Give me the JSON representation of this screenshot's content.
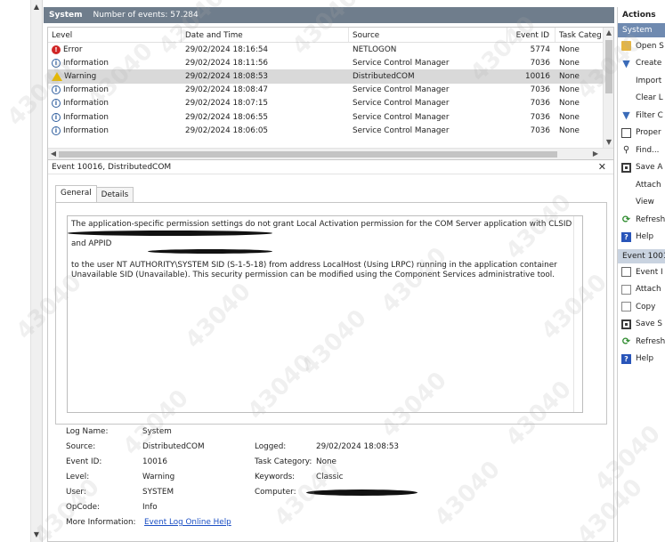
{
  "system_bar": {
    "title": "System",
    "count_text": "Number of events: 57.284"
  },
  "event_table": {
    "headers": [
      "Level",
      "Date and Time",
      "Source",
      "Event ID",
      "Task Categ"
    ],
    "rows": [
      {
        "level": "Error",
        "icon": "error-icon",
        "date": "29/02/2024 18:16:54",
        "source": "NETLOGON",
        "id": "5774",
        "task": "None"
      },
      {
        "level": "Information",
        "icon": "info-icon",
        "date": "29/02/2024 18:11:56",
        "source": "Service Control Manager",
        "id": "7036",
        "task": "None"
      },
      {
        "level": "Warning",
        "icon": "warning-icon",
        "date": "29/02/2024 18:08:53",
        "source": "DistributedCOM",
        "id": "10016",
        "task": "None",
        "selected": true
      },
      {
        "level": "Information",
        "icon": "info-icon",
        "date": "29/02/2024 18:08:47",
        "source": "Service Control Manager",
        "id": "7036",
        "task": "None"
      },
      {
        "level": "Information",
        "icon": "info-icon",
        "date": "29/02/2024 18:07:15",
        "source": "Service Control Manager",
        "id": "7036",
        "task": "None"
      },
      {
        "level": "Information",
        "icon": "info-icon",
        "date": "29/02/2024 18:06:55",
        "source": "Service Control Manager",
        "id": "7036",
        "task": "None"
      },
      {
        "level": "Information",
        "icon": "info-icon",
        "date": "29/02/2024 18:06:05",
        "source": "Service Control Manager",
        "id": "7036",
        "task": "None"
      }
    ]
  },
  "detail": {
    "title": "Event 10016, DistributedCOM",
    "tabs": [
      "General",
      "Details"
    ],
    "message": {
      "line1": "The application-specific permission settings do not grant Local Activation permission for the COM Server application with CLSID",
      "line2": "and APPID",
      "line3": "to the user NT AUTHORITY\\SYSTEM SID (S-1-5-18) from address LocalHost (Using LRPC) running in the application container",
      "line4": "Unavailable SID (Unavailable). This security permission can be modified using the Component Services administrative tool."
    },
    "props": {
      "log_name_label": "Log Name:",
      "log_name": "System",
      "source_label": "Source:",
      "source": "DistributedCOM",
      "event_id_label": "Event ID:",
      "event_id": "10016",
      "level_label": "Level:",
      "level": "Warning",
      "user_label": "User:",
      "user": "SYSTEM",
      "opcode_label": "OpCode:",
      "opcode": "Info",
      "more_info_label": "More Information:",
      "more_info_link": "Event Log Online Help",
      "logged_label": "Logged:",
      "logged": "29/02/2024 18:08:53",
      "task_label": "Task Category:",
      "task": "None",
      "keywords_label": "Keywords:",
      "keywords": "Classic",
      "computer_label": "Computer:"
    }
  },
  "actions": {
    "header": "Actions",
    "section_system": "System",
    "system_items": [
      {
        "label": "Open S",
        "icon": "folder-icon"
      },
      {
        "label": "Create",
        "icon": "filter-icon"
      },
      {
        "label": "Import",
        "icon": "blank-icon"
      },
      {
        "label": "Clear L",
        "icon": "blank-icon"
      },
      {
        "label": "Filter C",
        "icon": "filter-icon"
      },
      {
        "label": "Proper",
        "icon": "properties-icon"
      },
      {
        "label": "Find...",
        "icon": "find-icon"
      },
      {
        "label": "Save A",
        "icon": "save-icon"
      },
      {
        "label": "Attach",
        "icon": "blank-icon"
      },
      {
        "label": "View",
        "icon": "blank-icon"
      },
      {
        "label": "Refresh",
        "icon": "refresh-icon"
      },
      {
        "label": "Help",
        "icon": "help-icon"
      }
    ],
    "section_event": "Event 10016",
    "event_items": [
      {
        "label": "Event I",
        "icon": "event-icon"
      },
      {
        "label": "Attach",
        "icon": "attach-icon"
      },
      {
        "label": "Copy",
        "icon": "copy-icon"
      },
      {
        "label": "Save S",
        "icon": "save-icon"
      },
      {
        "label": "Refresh",
        "icon": "refresh-icon"
      },
      {
        "label": "Help",
        "icon": "help-icon"
      }
    ]
  },
  "watermark": "43040"
}
